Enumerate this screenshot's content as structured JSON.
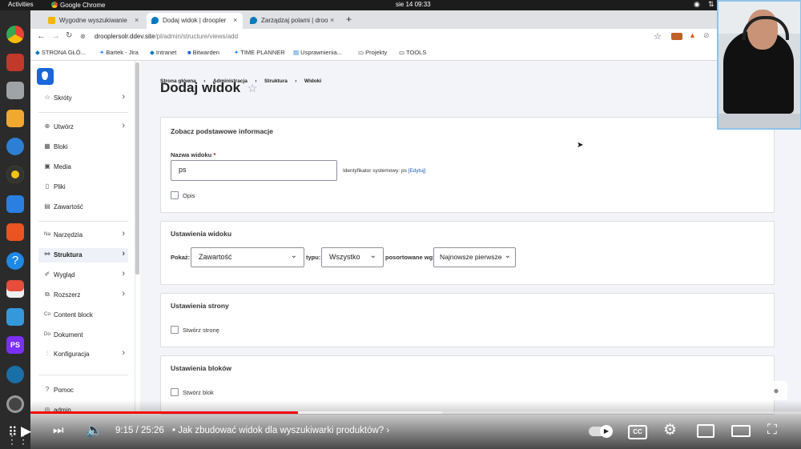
{
  "os_topbar": {
    "activities": "Activities",
    "app": "Google Chrome",
    "clock": "sie 14  09:33"
  },
  "browser": {
    "tabs": [
      {
        "title": "Wygodne wyszukiwanie"
      },
      {
        "title": "Dodaj widok | droopler"
      },
      {
        "title": "Zarządzaj polami | droop"
      }
    ],
    "new_tab": "+",
    "url_host": "drooplersolr.ddev.site",
    "url_path": "/pl/admin/structure/views/add",
    "bookmarks": [
      "STRONA GŁÓ...",
      "Bartek - Jira",
      "Intranet",
      "Bitwarden",
      "TIME PLANNER",
      "Usprawnienia...",
      "Projekty",
      "TOOLS"
    ]
  },
  "sidebar": {
    "items": [
      {
        "label": "Skróty",
        "icon": "star-icon"
      },
      {
        "label": "Utwórz",
        "icon": "plus-circle-icon"
      },
      {
        "label": "Bloki",
        "icon": "blocks-icon"
      },
      {
        "label": "Media",
        "icon": "media-icon"
      },
      {
        "label": "Pliki",
        "icon": "file-icon"
      },
      {
        "label": "Zawartość",
        "icon": "content-icon"
      },
      {
        "label": "Narzędzia",
        "icon": "tools-icon"
      },
      {
        "label": "Struktura",
        "icon": "structure-icon"
      },
      {
        "label": "Wygląd",
        "icon": "brush-icon"
      },
      {
        "label": "Rozszerz",
        "icon": "extend-icon"
      },
      {
        "label": "Content block",
        "icon": "content-block-icon"
      },
      {
        "label": "Dokument",
        "icon": "document-icon"
      },
      {
        "label": "Konfiguracja",
        "icon": "config-icon"
      },
      {
        "label": "Pomoc",
        "icon": "help-icon"
      },
      {
        "label": "admin",
        "icon": "user-icon"
      }
    ]
  },
  "page": {
    "breadcrumb": [
      "Strona główna",
      "Administracja",
      "Struktura",
      "Widoki"
    ],
    "title": "Dodaj widok",
    "basic": {
      "heading": "Zobacz podstawowe informacje",
      "name_label": "Nazwa widoku",
      "name_value": "ps",
      "machine_name": "Identyfikator systemowy: ps",
      "edit_link": "[Edytuj]",
      "description_label": "Opis"
    },
    "view_settings": {
      "heading": "Ustawienia widoku",
      "show_label": "Pokaż:",
      "show_value": "Zawartość",
      "type_label": "typu:",
      "type_value": "Wszystko",
      "sort_label": "posortowane wg:",
      "sort_value": "Najnowsze pierwsze"
    },
    "page_settings": {
      "heading": "Ustawienia strony",
      "create_page_label": "Stwórz stronę"
    },
    "block_settings": {
      "heading": "Ustawienia bloków",
      "create_block_label": "Stwórz blok"
    }
  },
  "player": {
    "time_current": "9:15",
    "time_total": "25:26",
    "chapter_title": "Jak zbudować widok dla wyszukiwarki produktów?",
    "progress_fraction": 0.347
  }
}
